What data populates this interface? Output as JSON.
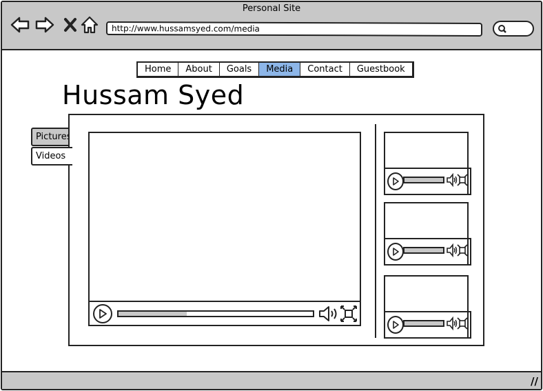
{
  "window": {
    "title": "Personal Site"
  },
  "address_bar": {
    "url": "http://www.hussamsyed.com/media"
  },
  "toolbar": {
    "icons": [
      "back-arrow-icon",
      "forward-arrow-icon",
      "close-x-icon",
      "home-icon",
      "search-icon"
    ]
  },
  "nav": {
    "items": [
      {
        "label": "Home"
      },
      {
        "label": "About"
      },
      {
        "label": "Goals"
      },
      {
        "label": "Media",
        "active": true
      },
      {
        "label": "Contact"
      },
      {
        "label": "Guestbook"
      }
    ],
    "active_color": "#8db6e8"
  },
  "page": {
    "heading": "Hussam Syed"
  },
  "side_tabs": [
    {
      "label": "Pictures",
      "selected": false
    },
    {
      "label": "Videos",
      "selected": true
    }
  ],
  "main_player": {
    "progress": 0.35
  },
  "thumb_players": [
    {
      "progress": 1.0
    },
    {
      "progress": 1.0
    },
    {
      "progress": 1.0
    }
  ]
}
